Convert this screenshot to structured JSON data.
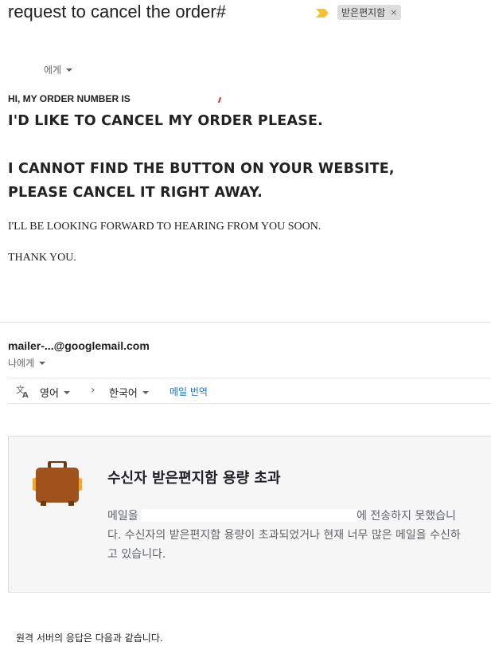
{
  "header": {
    "subject": "request to cancel the order#",
    "label_chip": "받은편지함",
    "label_chip_close": "×",
    "to_label": "에게",
    "importance_color": "#f4c430"
  },
  "original_message": {
    "hi_line": "HI, MY ORDER NUMBER IS",
    "line1": "I'D LIKE TO CANCEL MY ORDER PLEASE.",
    "line2": "I CANNOT FIND THE BUTTON ON YOUR WEBSITE,",
    "line3": "PLEASE CANCEL IT RIGHT AWAY.",
    "line4": "I'LL BE LOOKING FORWARD TO HEARING FROM YOU SOON.",
    "line5": "THANK YOU."
  },
  "bounce": {
    "sender": "mailer-...@googlemail.com",
    "to_me": "나에게",
    "translate": {
      "icon": "translate-icon",
      "source_lang": "영어",
      "arrow": "›",
      "target_lang": "한국어",
      "action": "메일 번역"
    },
    "card": {
      "icon": "briefcase-icon",
      "title": "수신자 받은편지함 용량 초과",
      "body_prefix": "메일을",
      "body_suffix": "에 전송하지 못했습니다. 수신자의 받은편지함 용량이 초과되었거나 현재 너무 많은 메일을 수신하고 있습니다."
    },
    "remote_response": "원격 서버의 응답은 다음과 같습니다."
  }
}
